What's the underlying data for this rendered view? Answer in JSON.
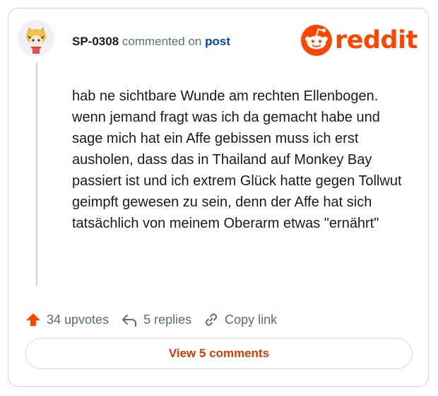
{
  "brand": {
    "logo_text": "reddit",
    "color": "#ff4500"
  },
  "comment": {
    "username": "SP-0308",
    "action_text": "commented on",
    "post_link_label": "post",
    "body": "hab ne sichtbare Wunde am rechten Ellenbogen. wenn jemand fragt was ich da gemacht habe und sage mich hat ein Affe gebissen muss ich erst ausholen, dass das in Thailand auf Monkey Bay passiert ist und ich extrem Glück hatte gegen Tollwut geimpft gewesen zu sein, denn der Affe hat sich tatsächlich von meinem Oberarm etwas \"ernährt\""
  },
  "actions": {
    "upvotes": "34 upvotes",
    "replies": "5 replies",
    "copy_link": "Copy link"
  },
  "view_comments_label": "View 5 comments",
  "colors": {
    "upvote_icon": "#ff4500",
    "link_blue": "#0045ac",
    "button_text": "#d93900",
    "muted_text": "#576f76"
  },
  "icons": [
    "avatar",
    "reddit-snoo-icon",
    "upvote-arrow-icon",
    "reply-arrow-icon",
    "link-chain-icon"
  ]
}
